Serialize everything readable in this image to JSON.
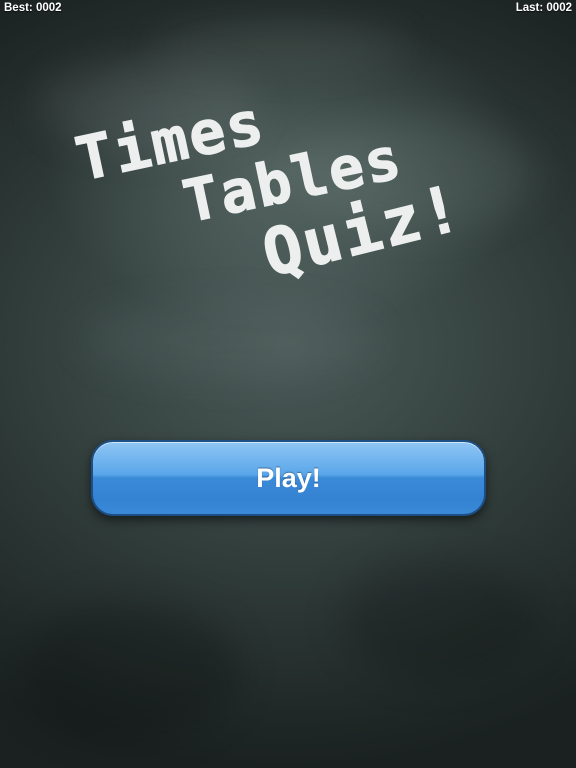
{
  "header": {
    "best_text": "Best: 0002",
    "last_text": "Last: 0002"
  },
  "title": {
    "line1": "Times",
    "line2": "Tables",
    "line3": "Quiz!"
  },
  "menu": {
    "play_label": "Play!"
  },
  "colors": {
    "board": "#2f3b39",
    "chalk": "#ecefee",
    "button_blue": "#3b8ad8"
  }
}
